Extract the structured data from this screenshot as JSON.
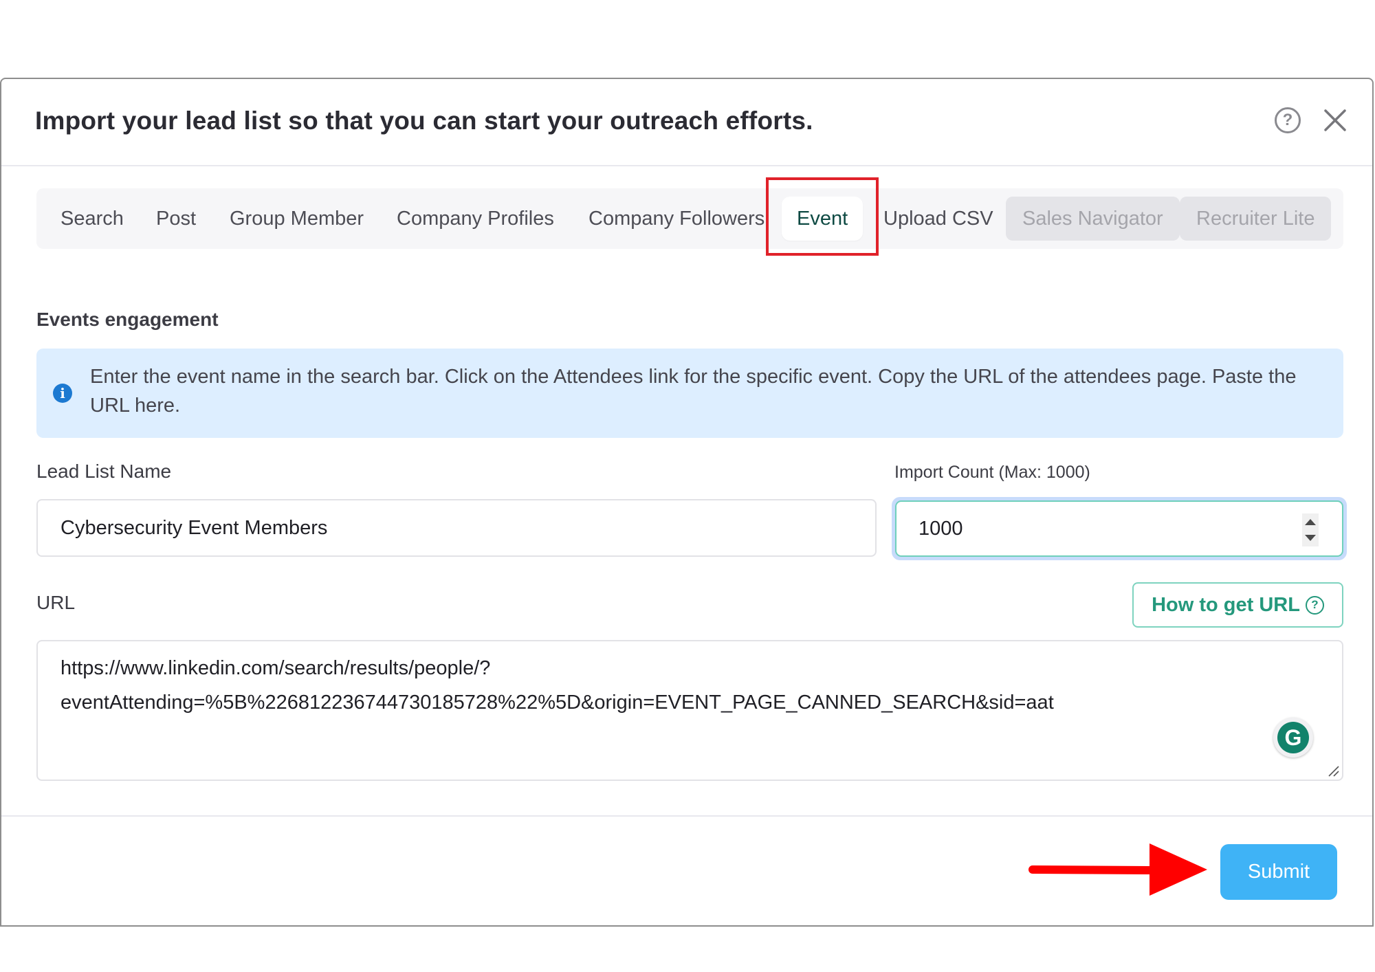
{
  "modal": {
    "title": "Import your lead list so that you can start your outreach efforts.",
    "help_icon": "question-circle-icon",
    "close_icon": "close-x-icon"
  },
  "tabs": [
    {
      "label": "Search",
      "state": "normal"
    },
    {
      "label": "Post",
      "state": "normal"
    },
    {
      "label": "Group Member",
      "state": "normal"
    },
    {
      "label": "Company Profiles",
      "state": "normal"
    },
    {
      "label": "Company Followers",
      "state": "normal"
    },
    {
      "label": "Event",
      "state": "active"
    },
    {
      "label": "Upload CSV",
      "state": "normal"
    },
    {
      "label": "Sales Navigator",
      "state": "disabled"
    },
    {
      "label": "Recruiter Lite",
      "state": "disabled"
    }
  ],
  "section": {
    "title": "Events engagement",
    "info_icon": "info-circle-icon",
    "info_text": "Enter the event name in the search bar. Click on the Attendees link for the specific event. Copy the URL of the attendees page. Paste the URL here."
  },
  "form": {
    "lead_list_name": {
      "label": "Lead List Name",
      "value": "Cybersecurity Event Members"
    },
    "import_count": {
      "label": "Import Count (Max: 1000)",
      "value": "1000"
    },
    "url": {
      "label": "URL",
      "help_button_label": "How to get URL",
      "value": "https://www.linkedin.com/search/results/people/?eventAttending=%5B%226812236744730185728%22%5D&origin=EVENT_PAGE_CANNED_SEARCH&sid=aat",
      "value_line1": "https://www.linkedin.com/search/results/people/?",
      "value_line2": "eventAttending=%5B%226812236744730185728%22%5D&origin=EVENT_PAGE_CANNED_SEARCH&sid=aat"
    }
  },
  "footer": {
    "submit_label": "Submit"
  },
  "annotations": {
    "highlight_color": "#e0222a",
    "highlighted_tab": "Event",
    "arrow_target": "Submit"
  },
  "colors": {
    "active_tab_text": "#0e4a43",
    "accent_green": "#24987c",
    "submit_blue": "#3fb3f6",
    "info_bg": "#ddeeff",
    "info_icon": "#1c79d1"
  }
}
